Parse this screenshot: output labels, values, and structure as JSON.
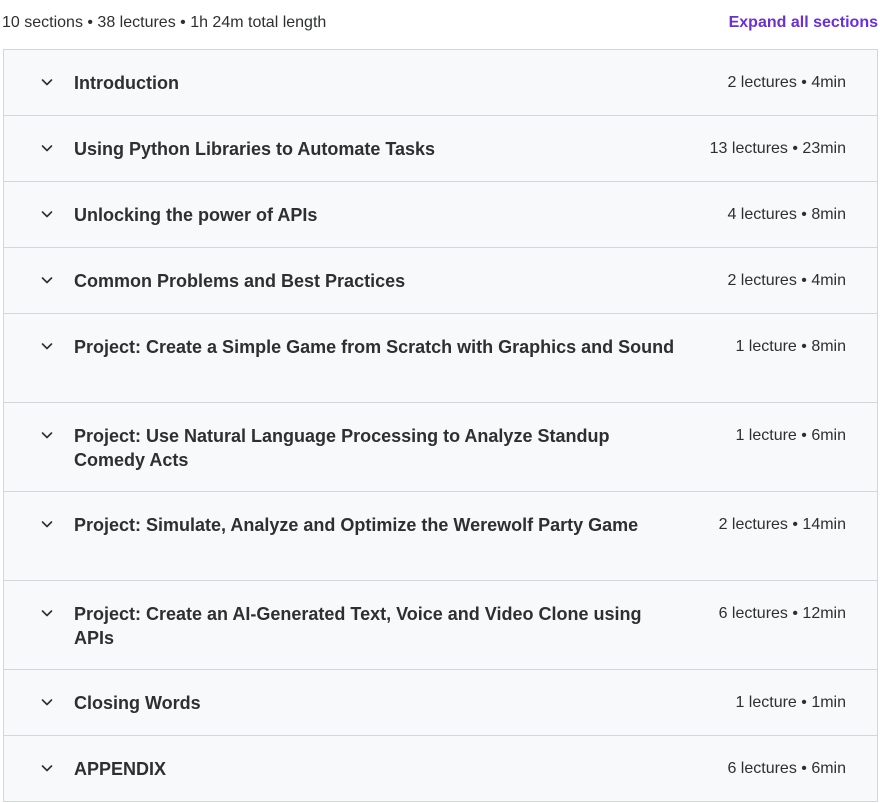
{
  "header": {
    "summary": "10 sections • 38 lectures • 1h 24m total length",
    "expand_label": "Expand all sections"
  },
  "colors": {
    "accent": "#6b2fd6",
    "row_background": "#f7f9fa",
    "border": "#d1d7dc",
    "text": "#2d2f31"
  },
  "icons": {
    "row_toggle": "chevron-down-icon"
  },
  "sections": [
    {
      "title": "Introduction",
      "meta": "2 lectures • 4min"
    },
    {
      "title": "Using Python Libraries to Automate Tasks",
      "meta": "13 lectures • 23min"
    },
    {
      "title": "Unlocking the power of APIs",
      "meta": "4 lectures • 8min"
    },
    {
      "title": "Common Problems and Best Practices",
      "meta": "2 lectures • 4min"
    },
    {
      "title": "Project: Create a Simple Game from Scratch with Graphics and Sound",
      "meta": "1 lecture • 8min"
    },
    {
      "title": "Project: Use Natural Language Processing to Analyze Standup Comedy Acts",
      "meta": "1 lecture • 6min"
    },
    {
      "title": "Project: Simulate, Analyze and Optimize the Werewolf Party Game",
      "meta": "2 lectures • 14min"
    },
    {
      "title": "Project: Create an AI-Generated Text, Voice and Video Clone using APIs",
      "meta": "6 lectures • 12min"
    },
    {
      "title": "Closing Words",
      "meta": "1 lecture • 1min"
    },
    {
      "title": "APPENDIX",
      "meta": "6 lectures • 6min"
    }
  ]
}
